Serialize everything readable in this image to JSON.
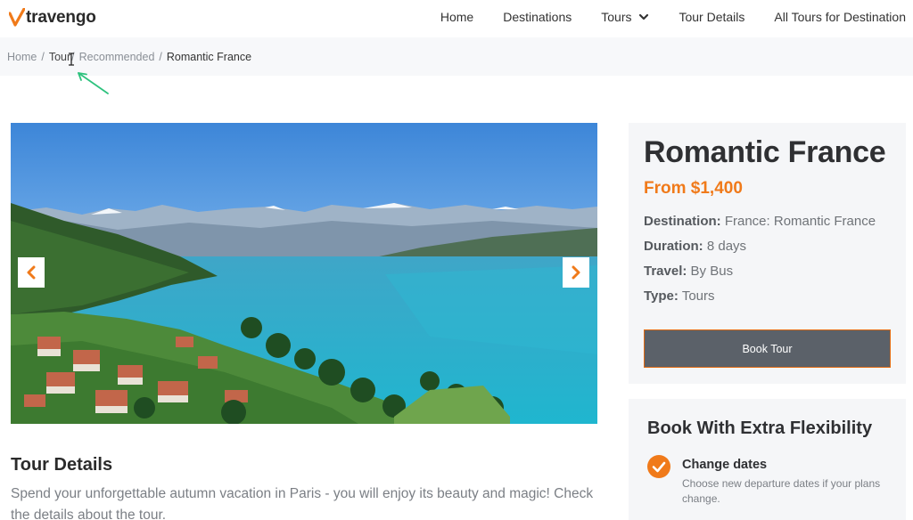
{
  "brand": {
    "name": "travengo",
    "accent": "#f07a1a"
  },
  "nav": {
    "items": [
      {
        "label": "Home"
      },
      {
        "label": "Destinations"
      },
      {
        "label": "Tours",
        "has_dropdown": true
      },
      {
        "label": "Tour Details"
      },
      {
        "label": "All Tours for Destination"
      }
    ]
  },
  "breadcrumb": {
    "items": [
      {
        "label": "Home"
      },
      {
        "label": "Tour"
      },
      {
        "label": "Recommended"
      }
    ],
    "separator": "/",
    "current": "Romantic France"
  },
  "slider": {
    "prev_icon": "chevron-left-icon",
    "next_icon": "chevron-right-icon",
    "image": "lakeside-alpine-village-photo"
  },
  "details": {
    "title": "Tour Details",
    "text": "Spend your unforgettable autumn vacation in Paris - you will enjoy its beauty and magic! Check the details about the tour."
  },
  "tour": {
    "name": "Romantic France",
    "price": "From $1,400",
    "meta": [
      {
        "label": "Destination:",
        "value": "France: Romantic France"
      },
      {
        "label": "Duration:",
        "value": "8 days"
      },
      {
        "label": "Travel:",
        "value": "By Bus"
      },
      {
        "label": "Type:",
        "value": "Tours"
      }
    ],
    "book_label": "Book Tour"
  },
  "flex": {
    "title": "Book With Extra Flexibility",
    "items": [
      {
        "title": "Change dates",
        "text": "Choose new departure dates if your plans change."
      }
    ]
  },
  "colors": {
    "accent": "#f07a1a",
    "button": "#5b6169",
    "card_bg": "#f5f6f8",
    "annotation_arrow": "#2ec27e"
  }
}
